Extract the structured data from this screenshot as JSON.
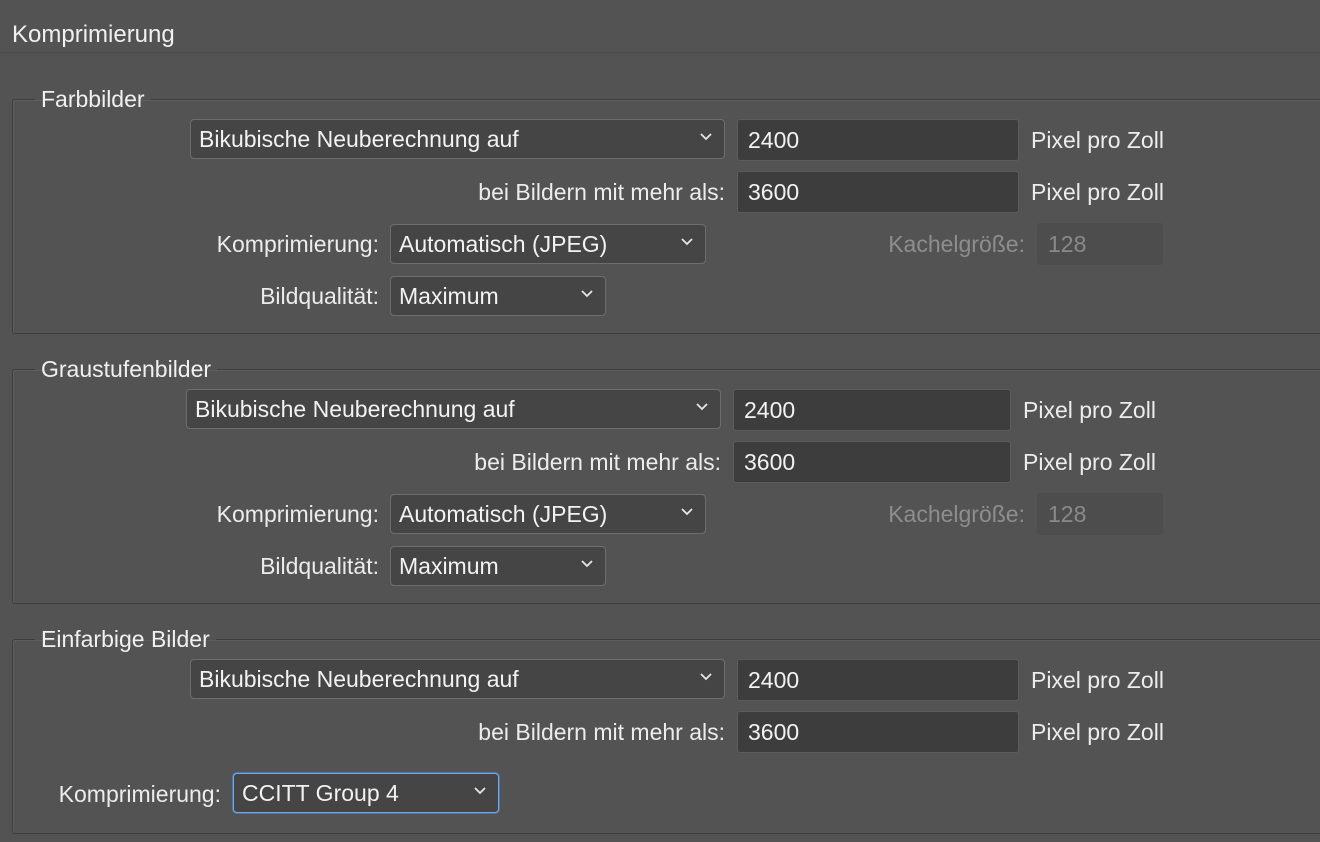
{
  "title": "Komprimierung",
  "groups": [
    {
      "legend": "Farbbilder",
      "resample": {
        "method": "Bikubische Neuberechnung auf",
        "value": "2400",
        "unit": "Pixel pro Zoll"
      },
      "threshold": {
        "label": "bei Bildern mit mehr als:",
        "value": "3600",
        "unit": "Pixel pro Zoll"
      },
      "compression": {
        "label": "Komprimierung:",
        "value": "Automatisch (JPEG)"
      },
      "tile": {
        "label": "Kachelgröße:",
        "value": "128"
      },
      "quality": {
        "label": "Bildqualität:",
        "value": "Maximum"
      }
    },
    {
      "legend": "Graustufenbilder",
      "resample": {
        "method": "Bikubische Neuberechnung auf",
        "value": "2400",
        "unit": "Pixel pro Zoll"
      },
      "threshold": {
        "label": "bei Bildern mit mehr als:",
        "value": "3600",
        "unit": "Pixel pro Zoll"
      },
      "compression": {
        "label": "Komprimierung:",
        "value": "Automatisch (JPEG)"
      },
      "tile": {
        "label": "Kachelgröße:",
        "value": "128"
      },
      "quality": {
        "label": "Bildqualität:",
        "value": "Maximum"
      }
    },
    {
      "legend": "Einfarbige Bilder",
      "resample": {
        "method": "Bikubische Neuberechnung auf",
        "value": "2400",
        "unit": "Pixel pro Zoll"
      },
      "threshold": {
        "label": "bei Bildern mit mehr als:",
        "value": "3600",
        "unit": "Pixel pro Zoll"
      },
      "compression": {
        "label": "Komprimierung:",
        "value": "CCITT Group 4"
      }
    }
  ]
}
